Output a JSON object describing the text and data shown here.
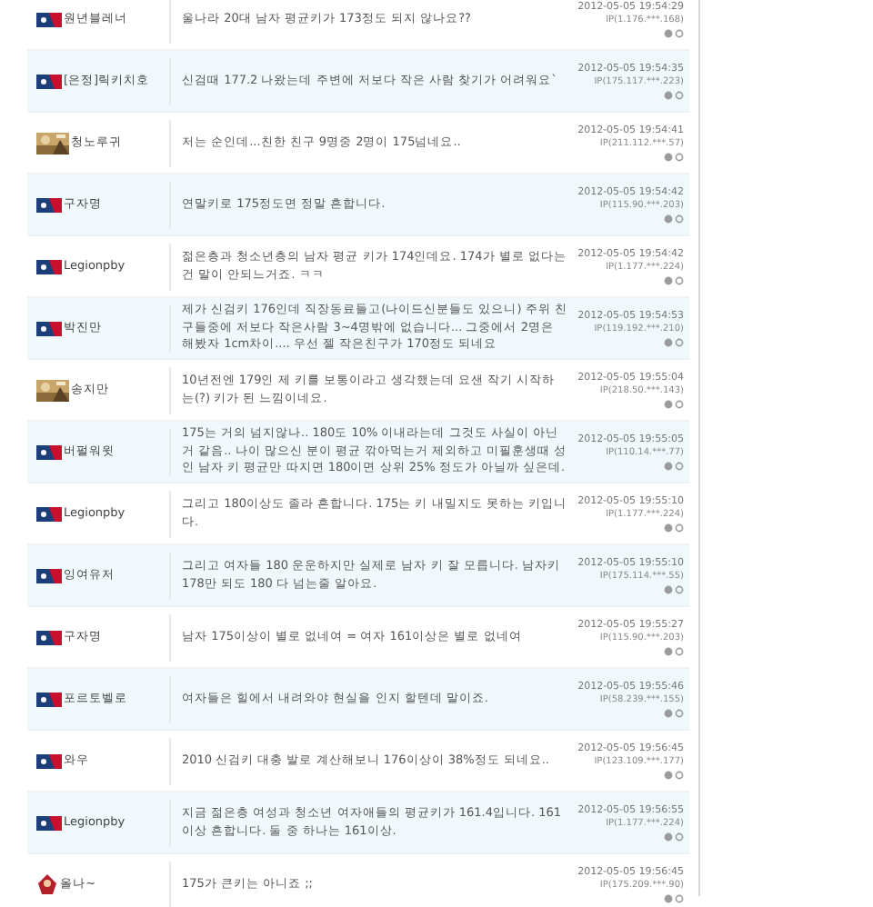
{
  "comments": [
    {
      "kind": "logo",
      "nickname": "원년블레너",
      "text": "울나라 20대 남자 평균키가 173정도 되지 않나요??",
      "time": "2012-05-05 19:54:29",
      "ip": "IP(1.176.***.168)"
    },
    {
      "kind": "logo",
      "nickname": "[은정]릭키치호",
      "text": "신검때 177.2 나왔는데 주변에 저보다 작은 사람 찾기가 어려워요`",
      "time": "2012-05-05 19:54:35",
      "ip": "IP(175.117.***.223)"
    },
    {
      "nickname": "청노루귀",
      "text": "저는 순인데...친한 친구 9명중 2명이 175넘네요..",
      "time": "2012-05-05 19:54:41",
      "ip": "IP(211.112.***.57)"
    },
    {
      "kind": "logo",
      "nickname": "구자명",
      "text": "연말키로 175정도면 정말 흔합니다.",
      "time": "2012-05-05 19:54:42",
      "ip": "IP(115.90.***.203)"
    },
    {
      "kind": "logo",
      "nickname": "Legionpby",
      "text": "젊은층과 청소년층의 남자 평균 키가 174인데요. 174가 별로 없다는건 말이 안되느거죠. ㅋㅋ",
      "time": "2012-05-05 19:54:42",
      "ip": "IP(1.177.***.224)"
    },
    {
      "kind": "logo",
      "nickname": "박진만",
      "text": "제가 신검키 176인데 직장동료들고(나이드신분들도 있으니) 주위 친구들중에 저보다 작은사람 3~4명밖에 없습니다... 그중에서 2명은 해봤자 1cm차이.... 우선 젤 작은친구가 170정도 되네요",
      "time": "2012-05-05 19:54:53",
      "ip": "IP(119.192.***.210)"
    },
    {
      "nickname": "송지만",
      "text": "10년전엔 179인 제 키를 보통이라고 생각했는데 요샌 작기 시작하는(?) 키가 된 느낌이네요.",
      "time": "2012-05-05 19:55:04",
      "ip": "IP(218.50.***.143)"
    },
    {
      "kind": "logo",
      "nickname": "버펄워윗",
      "text": "175는 거의 넘지않나.. 180도 10% 이내라는데 그것도 사실이 아닌거 같음.. 나이 많으신 분이 평균 깎아먹는거 제외하고 미필훈생때 성인 남자 키 평균만 따지면 180이면 상위 25% 정도가 아닐까 싶은데.",
      "time": "2012-05-05 19:55:05",
      "ip": "IP(110.14.***.77)"
    },
    {
      "kind": "logo",
      "nickname": "Legionpby",
      "text": "그리고 180이상도 졸라 흔합니다. 175는 키 내밀지도 못하는 키입니다.",
      "time": "2012-05-05 19:55:10",
      "ip": "IP(1.177.***.224)"
    },
    {
      "kind": "logo",
      "nickname": "잉여유저",
      "text": "그리고 여자들 180 운운하지만 실제로 남자 키 잘 모릅니다. 남자키 178만 되도 180 다 넘는줄 알아요.",
      "time": "2012-05-05 19:55:10",
      "ip": "IP(175.114.***.55)"
    },
    {
      "kind": "logo",
      "nickname": "구자명",
      "text": "남자 175이상이 별로 없네여 = 여자 161이상은 별로 없네여",
      "time": "2012-05-05 19:55:27",
      "ip": "IP(115.90.***.203)"
    },
    {
      "kind": "logo",
      "nickname": "포르토벨로",
      "text": "여자들은 힐에서 내려와야 현실을 인지 할텐데 말이죠.",
      "time": "2012-05-05 19:55:46",
      "ip": "IP(58.239.***.155)"
    },
    {
      "kind": "logo",
      "nickname": "와우",
      "text": "2010 신검키 대충 발로 계산해보니 176이상이 38%정도 되네요..",
      "time": "2012-05-05 19:56:45",
      "ip": "IP(123.109.***.177)"
    },
    {
      "kind": "logo",
      "nickname": "Legionpby",
      "text": "지금 젊은층 여성과 청소년 여자애들의 평균키가 161.4입니다. 161이상 흔합니다. 둘 중 하나는 161이상.",
      "time": "2012-05-05 19:56:55",
      "ip": "IP(1.177.***.224)"
    },
    {
      "kind": "character",
      "nickname": "올나~",
      "text": "175가 큰키는 아니죠 ;;",
      "time": "2012-05-05 19:56:45",
      "ip": "IP(175.209.***.90)"
    }
  ]
}
